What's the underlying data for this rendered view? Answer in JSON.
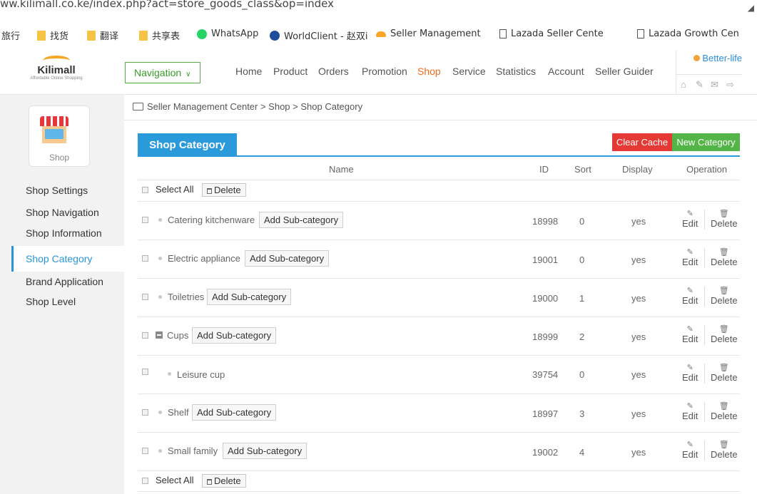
{
  "browser": {
    "url": "ww.kilimall.co.ke/index.php?act=store_goods_class&op=index",
    "bookmarks": [
      {
        "label": "旅行",
        "icon": "none"
      },
      {
        "label": "找货",
        "icon": "folder-icon"
      },
      {
        "label": "翻译",
        "icon": "folder-icon"
      },
      {
        "label": "共享表",
        "icon": "folder-icon"
      },
      {
        "label": "WhatsApp",
        "icon": "whatsapp-icon"
      },
      {
        "label": "WorldClient - 赵双i",
        "icon": "globe-icon"
      },
      {
        "label": "Seller Management",
        "icon": "kilimall-icon"
      },
      {
        "label": "Lazada Seller Cente",
        "icon": "page-icon"
      },
      {
        "label": "Lazada Growth Cen",
        "icon": "page-icon"
      }
    ]
  },
  "header": {
    "logo": {
      "name": "Kilimall",
      "tagline": "Affordable Online Shopping"
    },
    "nav_button": "Navigation",
    "menu": [
      "Home",
      "Product",
      "Orders",
      "Promotion",
      "Shop",
      "Service",
      "Statistics",
      "Account",
      "Seller Guider"
    ],
    "active_menu": "Shop",
    "user": "Better-life",
    "icons": [
      "home-icon",
      "wrench-icon",
      "mail-icon",
      "logout-icon"
    ]
  },
  "sidebar": {
    "shop_label": "Shop",
    "items": [
      "Shop Settings",
      "Shop Navigation",
      "Shop Information",
      "Shop Category",
      "Brand Application",
      "Shop Level"
    ],
    "active": "Shop Category"
  },
  "breadcrumb": "Seller Management Center > Shop > Shop Category",
  "main": {
    "tab": "Shop Category",
    "clear_cache": "Clear Cache",
    "new_category": "New Category",
    "columns": [
      "Name",
      "ID",
      "Sort",
      "Display",
      "Operation"
    ],
    "select_all": "Select All",
    "delete": "Delete",
    "add_sub": "Add Sub-category",
    "edit": "Edit",
    "rows": [
      {
        "name": "Catering kitchenware",
        "id": "18998",
        "sort": "0",
        "display": "yes"
      },
      {
        "name": "Electric appliance",
        "id": "19001",
        "sort": "0",
        "display": "yes"
      },
      {
        "name": "Toiletries",
        "id": "19000",
        "sort": "1",
        "display": "yes"
      },
      {
        "name": "Cups",
        "id": "18999",
        "sort": "2",
        "display": "yes"
      },
      {
        "name": "Leisure cup",
        "id": "39754",
        "sort": "0",
        "display": "yes"
      },
      {
        "name": "Shelf",
        "id": "18997",
        "sort": "3",
        "display": "yes"
      },
      {
        "name": "Small family",
        "id": "19002",
        "sort": "4",
        "display": "yes"
      }
    ]
  }
}
